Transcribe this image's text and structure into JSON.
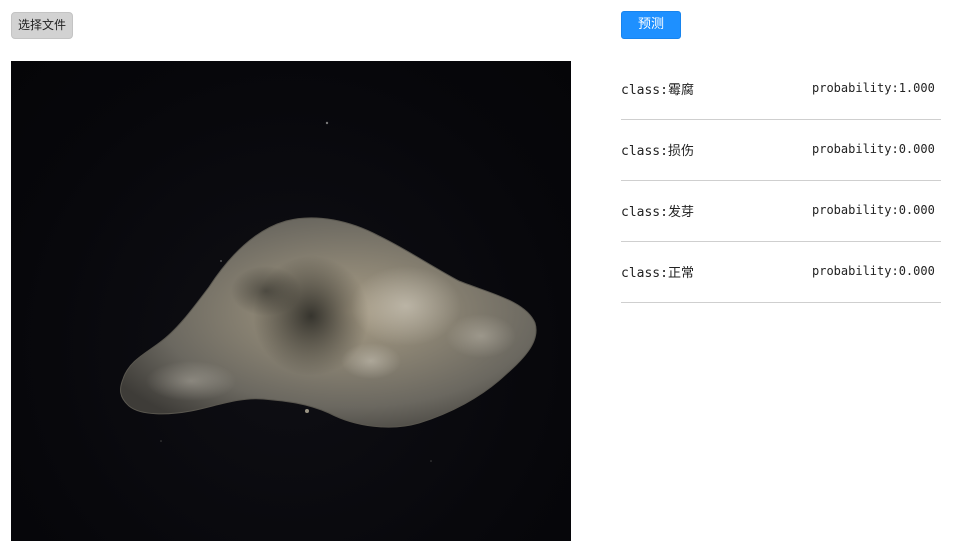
{
  "toolbar": {
    "choose_file_label": "选择文件",
    "predict_label": "预测"
  },
  "preview": {
    "subject": "tuber-photo"
  },
  "results": [
    {
      "class_text": "class:霉腐",
      "probability_text": "probability:1.000"
    },
    {
      "class_text": "class:损伤",
      "probability_text": "probability:0.000"
    },
    {
      "class_text": "class:发芽",
      "probability_text": "probability:0.000"
    },
    {
      "class_text": "class:正常",
      "probability_text": "probability:0.000"
    }
  ],
  "colors": {
    "predict_button": "#1e90ff",
    "file_button": "#d2d2d2",
    "divider": "#cfcfcf",
    "image_background": "#07070b"
  }
}
